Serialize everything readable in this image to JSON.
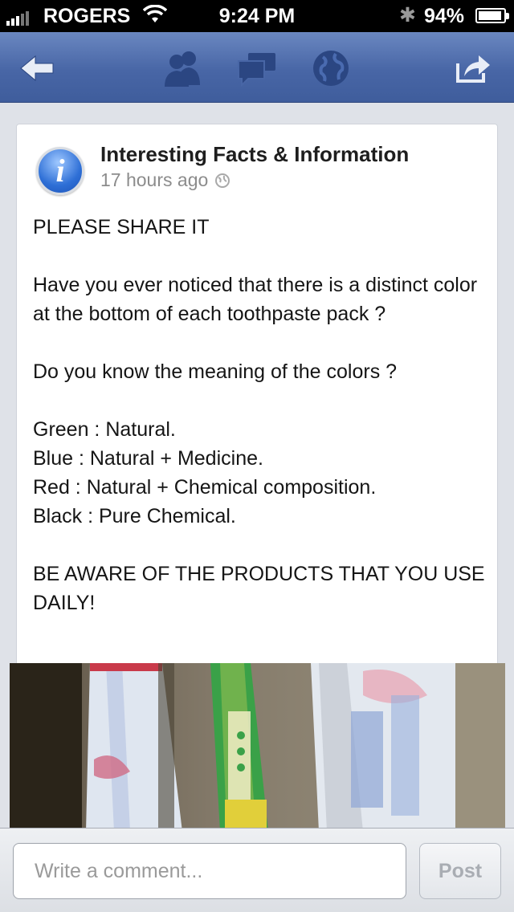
{
  "status_bar": {
    "carrier": "ROGERS",
    "time": "9:24 PM",
    "battery": "94%",
    "battery_level": 0.94
  },
  "nav": {
    "icons": [
      "back-arrow-icon",
      "friends-icon",
      "messages-icon",
      "globe-notifications-icon",
      "share-icon"
    ],
    "accent": "#4866a6"
  },
  "post": {
    "page_name": "Interesting Facts & Information",
    "timestamp": "17 hours ago",
    "privacy_icon": "globe-icon",
    "paragraphs": [
      "PLEASE SHARE IT",
      "Have you ever noticed that there is a distinct color at the bottom of each toothpaste pack ?",
      "Do you know the meaning of the colors ?",
      "Green : Natural.\nBlue : Natural + Medicine.\nRed : Natural + Chemical composition.\nBlack : Pure Chemical.",
      "BE AWARE OF THE PRODUCTS THAT YOU USE DAILY!"
    ]
  },
  "comment_bar": {
    "placeholder": "Write a comment...",
    "post_label": "Post"
  }
}
